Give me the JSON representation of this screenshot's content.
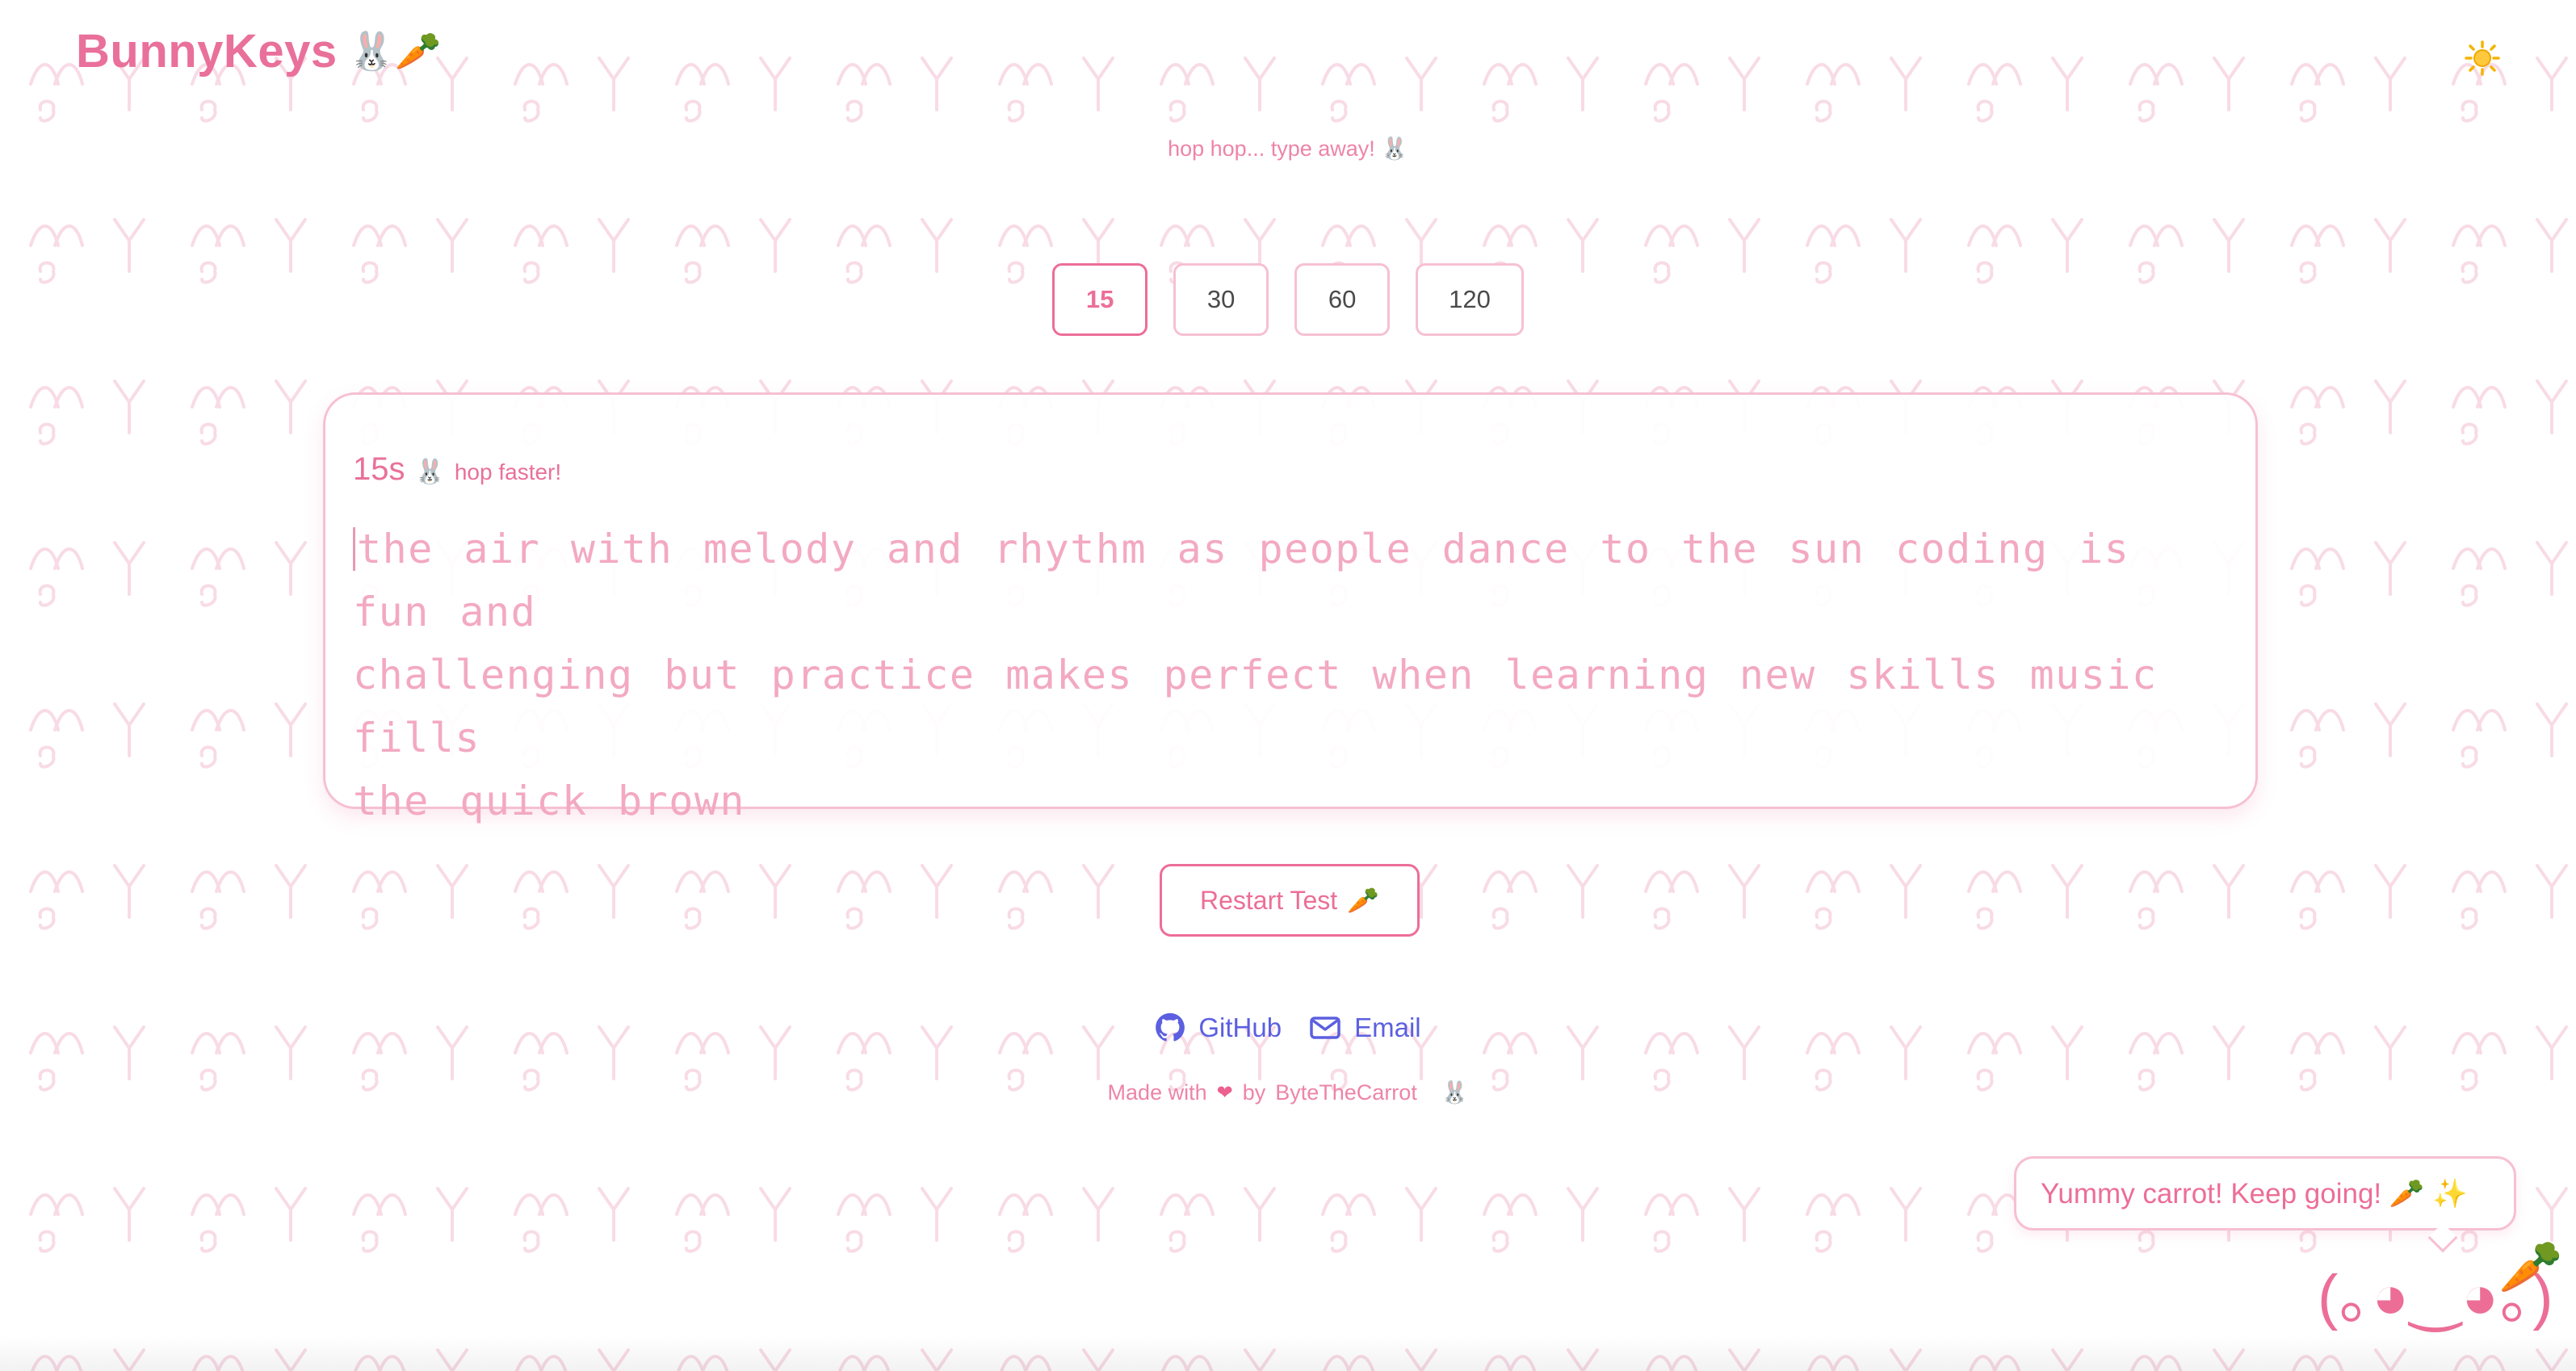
{
  "brand": {
    "name": "BunnyKeys",
    "emoji": "🐰🥕"
  },
  "header": {
    "theme_toggle_icon": "sun-icon"
  },
  "tagline": "hop hop... type away! 🐰",
  "durations": {
    "options": [
      "15",
      "30",
      "60",
      "120"
    ],
    "selected": "15"
  },
  "typing_card": {
    "timer_value": "15s",
    "timer_emoji": "🐰",
    "timer_hint": "hop faster!",
    "lines": [
      "the air with melody and rhythm as people dance to the sun coding is fun and",
      "challenging but practice makes perfect when learning new skills music fills",
      "the quick brown"
    ]
  },
  "restart": {
    "label": "Restart Test",
    "emoji": "🥕"
  },
  "links": {
    "github": "GitHub",
    "email": "Email"
  },
  "footer": {
    "made_with": "Made with",
    "heart": "❤",
    "by": "by",
    "author": "ByteTheCarrot",
    "emoji": "🐰"
  },
  "mascot": {
    "speech": "Yummy carrot! Keep going! 🥕 ✨",
    "face": "(｡◕‿◕｡)",
    "carrot": "🥕"
  },
  "colors": {
    "accent": "#ec6e97",
    "soft_accent": "#f6c0d3",
    "text_pink": "#f3a9c1",
    "link_blue": "#5b5fe0"
  }
}
